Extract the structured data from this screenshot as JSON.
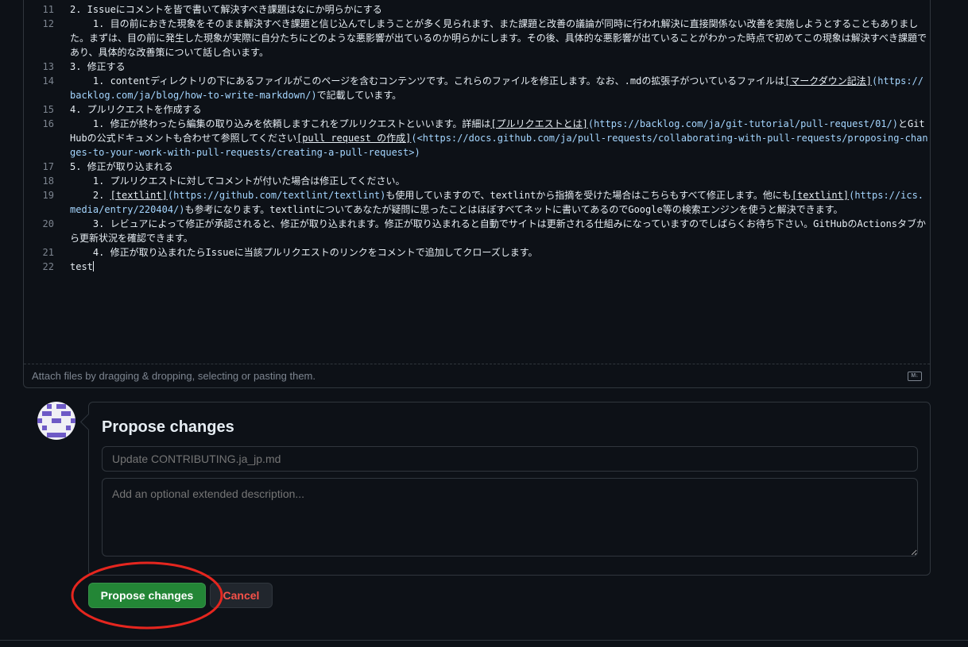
{
  "editor": {
    "lines": [
      {
        "num": "11",
        "segments": [
          {
            "t": "2. Issueにコメントを皆で書いて解決すべき課題はなにか明らかにする"
          }
        ]
      },
      {
        "num": "12",
        "segments": [
          {
            "t": "    1. 目の前におきた現象をそのまま解決すべき課題と信じ込んでしまうことが多く見られます、また課題と改善の議論が同時に行われ解決に直接関係ない改善を実施しようとすることもありました。まずは、目の前に発生した現象が実際に自分たちにどのような悪影響が出ているのか明らかにします。その後、具体的な悪影響が出ていることがわかった時点で初めてこの現象は解決すべき課題であり、具体的な改善策について話し合います。"
          }
        ]
      },
      {
        "num": "13",
        "segments": [
          {
            "t": "3. 修正する"
          }
        ]
      },
      {
        "num": "14",
        "segments": [
          {
            "t": "    1. contentディレクトリの下にあるファイルがこのページを含むコンテンツです。これらのファイルを修正します。なお、.mdの拡張子がついているファイルは"
          },
          {
            "t": "[マークダウン記法]",
            "c": "ref"
          },
          {
            "t": "(https://backlog.com/ja/blog/how-to-write-markdown/)",
            "c": "link"
          },
          {
            "t": "で記載しています。"
          }
        ]
      },
      {
        "num": "15",
        "segments": [
          {
            "t": "4. プルリクエストを作成する"
          }
        ]
      },
      {
        "num": "16",
        "segments": [
          {
            "t": "    1. 修正が終わったら編集の取り込みを依頼しますこれをプルリクエストといいます。詳細は"
          },
          {
            "t": "[プルリクエストとは]",
            "c": "ref"
          },
          {
            "t": "(https://backlog.com/ja/git-tutorial/pull-request/01/)",
            "c": "link"
          },
          {
            "t": "とGitHubの公式ドキュメントも合わせて参照してください"
          },
          {
            "t": "[pull request の作成]",
            "c": "ref"
          },
          {
            "t": "(<https://docs.github.com/ja/pull-requests/collaborating-with-pull-requests/proposing-changes-to-your-work-with-pull-requests/creating-a-pull-request>)",
            "c": "link"
          }
        ]
      },
      {
        "num": "17",
        "segments": [
          {
            "t": "5. 修正が取り込まれる"
          }
        ]
      },
      {
        "num": "18",
        "segments": [
          {
            "t": "    1. プルリクエストに対してコメントが付いた場合は修正してください。"
          }
        ]
      },
      {
        "num": "19",
        "segments": [
          {
            "t": "    2. "
          },
          {
            "t": "[textlint]",
            "c": "ref"
          },
          {
            "t": "(https://github.com/textlint/textlint)",
            "c": "link"
          },
          {
            "t": "も使用していますので、textlintから指摘を受けた場合はこちらもすべて修正します。他にも"
          },
          {
            "t": "[textlint]",
            "c": "ref"
          },
          {
            "t": "(https://ics.media/entry/220404/)",
            "c": "link"
          },
          {
            "t": "も参考になります。textlintについてあなたが疑問に思ったことはほぼすべてネットに書いてあるのでGoogle等の検索エンジンを使うと解決できます。"
          }
        ]
      },
      {
        "num": "20",
        "segments": [
          {
            "t": "    3. レビュアによって修正が承認されると、修正が取り込まれます。修正が取り込まれると自動でサイトは更新される仕組みになっていますのでしばらくお待ち下さい。GitHubのActionsタブから更新状況を確認できます。"
          }
        ]
      },
      {
        "num": "21",
        "segments": [
          {
            "t": "    4. 修正が取り込まれたらIssueに当該プルリクエストのリンクをコメントで追加してクローズします。"
          }
        ]
      },
      {
        "num": "22",
        "segments": [
          {
            "t": "test"
          }
        ],
        "cursor": true
      }
    ],
    "attach_hint": "Attach files by dragging & dropping, selecting or pasting them.",
    "markdown_icon": "markdown-icon"
  },
  "propose": {
    "heading": "Propose changes",
    "title_placeholder": "Update CONTRIBUTING.ja_jp.md",
    "title_value": "",
    "description_placeholder": "Add an optional extended description...",
    "description_value": ""
  },
  "actions": {
    "propose_label": "Propose changes",
    "cancel_label": "Cancel"
  },
  "colors": {
    "background": "#0d1117",
    "primary_button": "#238636",
    "cancel_text": "#f85149",
    "annotation": "#e5261f",
    "link": "#a5d6ff"
  }
}
